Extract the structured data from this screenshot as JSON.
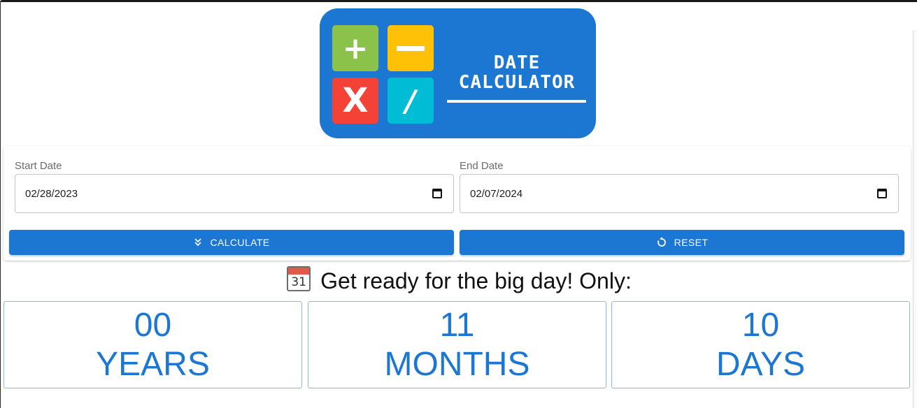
{
  "logo": {
    "tiles": [
      "+",
      "X",
      "/"
    ],
    "title_line1": "DATE",
    "title_line2": "CALCULATOR"
  },
  "form": {
    "start_label": "Start Date",
    "start_value": "02/28/2023",
    "end_label": "End Date",
    "end_value": "02/07/2024",
    "calculate_label": "CALCULATE",
    "reset_label": "RESET"
  },
  "message": {
    "emoji_number": "31",
    "text": "Get ready for the big day! Only:"
  },
  "results": [
    {
      "value": "00",
      "unit": "YEARS"
    },
    {
      "value": "11",
      "unit": "MONTHS"
    },
    {
      "value": "10",
      "unit": "DAYS"
    }
  ],
  "colors": {
    "primary": "#1c77d2",
    "tile_green": "#8bc34a",
    "tile_yellow": "#ffc107",
    "tile_red": "#f44336",
    "tile_cyan": "#00bcd4"
  },
  "icons": {
    "calculate": "double-chevron-down-icon",
    "reset": "refresh-icon",
    "date_picker": "calendar-icon"
  }
}
